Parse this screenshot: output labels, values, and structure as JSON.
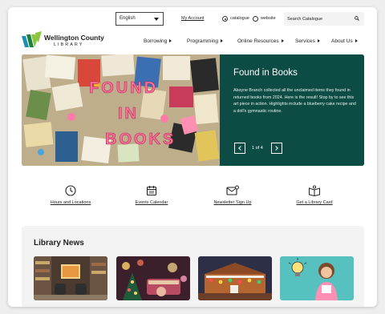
{
  "utility": {
    "language": "English",
    "my_account": "My Account",
    "search_scope_options": [
      "catalogue",
      "website"
    ],
    "search_scope_selected": "catalogue",
    "search_placeholder": "Search Catalogue"
  },
  "brand": {
    "name_line1": "Wellington County",
    "name_line2": "LIBRARY",
    "colors": [
      "#1d7f3d",
      "#8cc63f",
      "#1b8fb0"
    ]
  },
  "nav": {
    "items": [
      {
        "label": "Borrowing"
      },
      {
        "label": "Programming"
      },
      {
        "label": "Online Resources"
      },
      {
        "label": "Services"
      },
      {
        "label": "About Us"
      }
    ]
  },
  "hero": {
    "title": "Found in Books",
    "body": "Aboyne Branch collected all the unclaimed items they found in returned books from 2024. Here is the result! Stop by to see this art piece in action. Highlights include a blueberry cake recipe and a doll's gymnastic routine.",
    "pager": "1 of 4",
    "image_word_1": "FOUND",
    "image_word_2": "IN",
    "image_word_3": "BOOKS",
    "accent_color": "#0d4c45"
  },
  "quick_links": [
    {
      "label": "Hours and Locations",
      "icon": "clock-icon"
    },
    {
      "label": "Events Calendar",
      "icon": "calendar-icon"
    },
    {
      "label": "Newsletter Sign Up",
      "icon": "mail-icon"
    },
    {
      "label": "Get a Library Card",
      "icon": "book-icon"
    }
  ],
  "news": {
    "title": "Library News"
  }
}
